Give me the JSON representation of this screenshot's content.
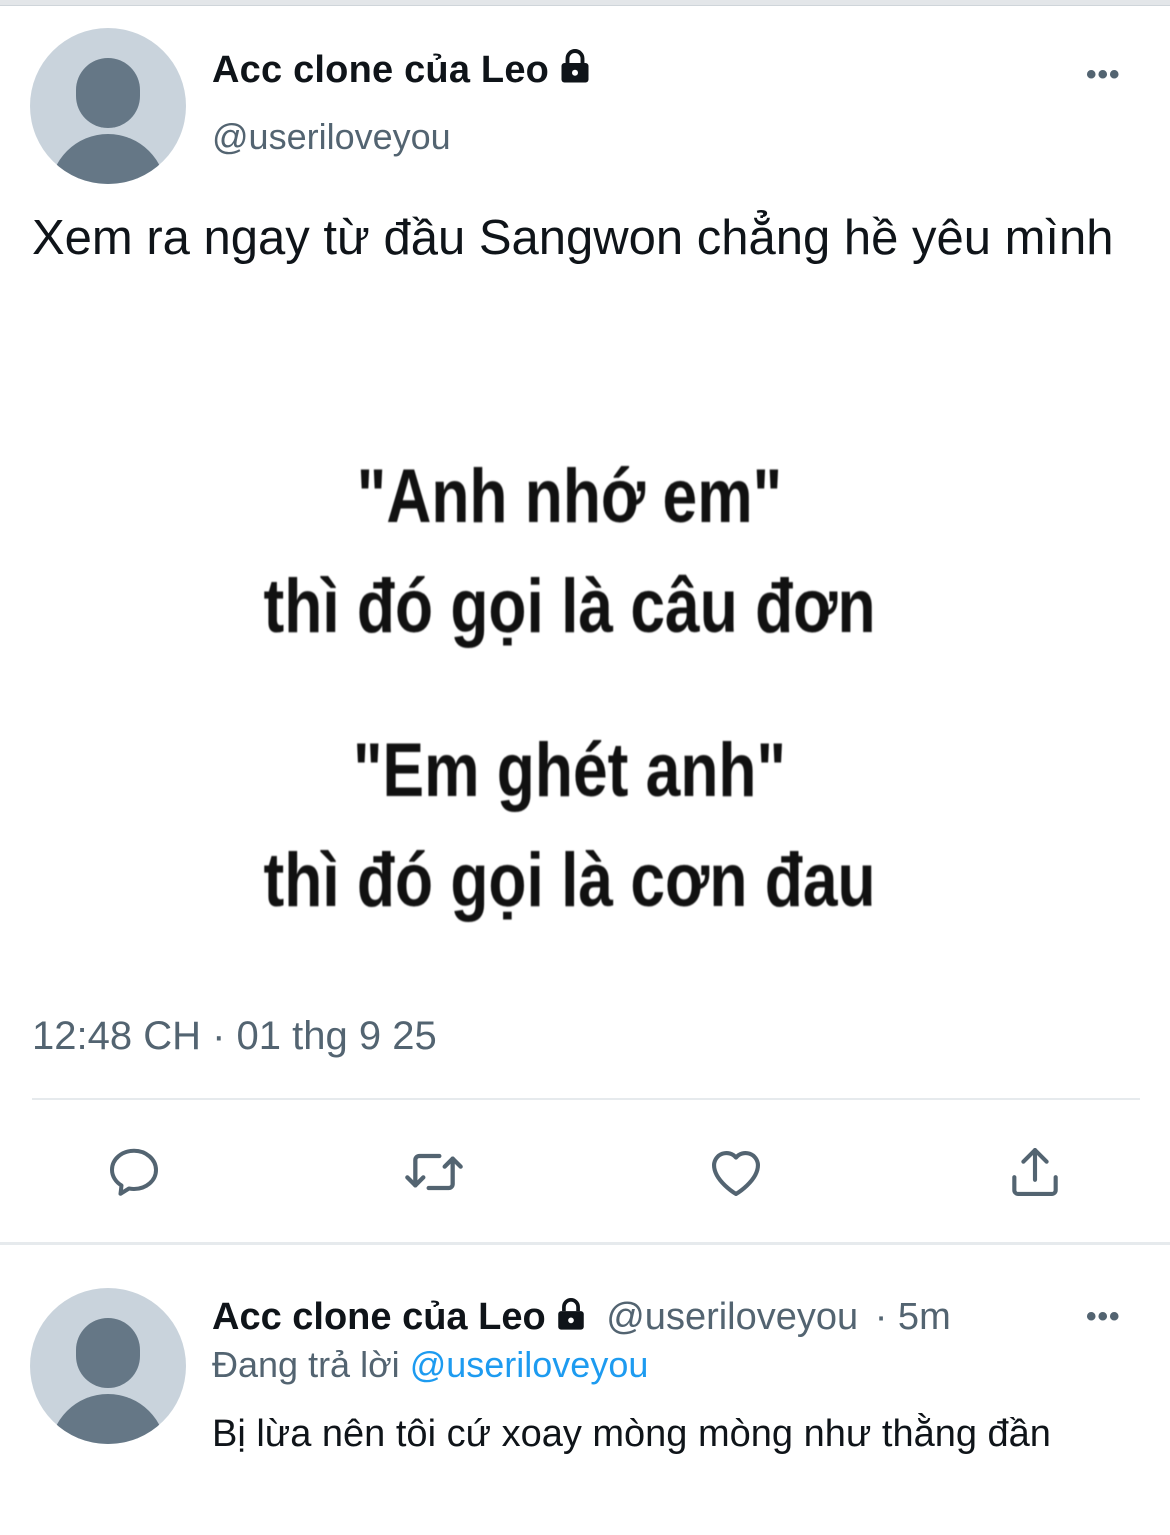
{
  "tweet": {
    "author_name": "Acc clone của Leo",
    "author_handle": "@useriloveyou",
    "more_label": "•••",
    "text": "Xem ra ngay từ đầu Sangwon chẳng hề yêu mình",
    "media": {
      "line1": "\"Anh nhớ em\"",
      "line2": "thì đó gọi là câu đơn",
      "line3": "\"Em ghét anh\"",
      "line4": "thì đó gọi là cơn đau"
    },
    "timestamp": "12:48 CH · 01 thg 9 25",
    "actions": {
      "reply_icon": "reply-icon",
      "retweet_icon": "retweet-icon",
      "like_icon": "heart-icon",
      "share_icon": "share-icon"
    }
  },
  "reply": {
    "author_name": "Acc clone của Leo",
    "author_handle": "@useriloveyou",
    "time": "· 5m",
    "more_label": "•••",
    "replying_prefix": "Đang trả lời",
    "replying_to": "@useriloveyou",
    "text": "Bị lừa nên tôi cứ xoay mòng mòng như thằng đần"
  },
  "colors": {
    "text_primary": "#0f1419",
    "text_secondary": "#536471",
    "link": "#1d9bf0",
    "avatar_bg": "#c9d3dc",
    "avatar_fg": "#657786",
    "divider": "#e6eaed"
  }
}
